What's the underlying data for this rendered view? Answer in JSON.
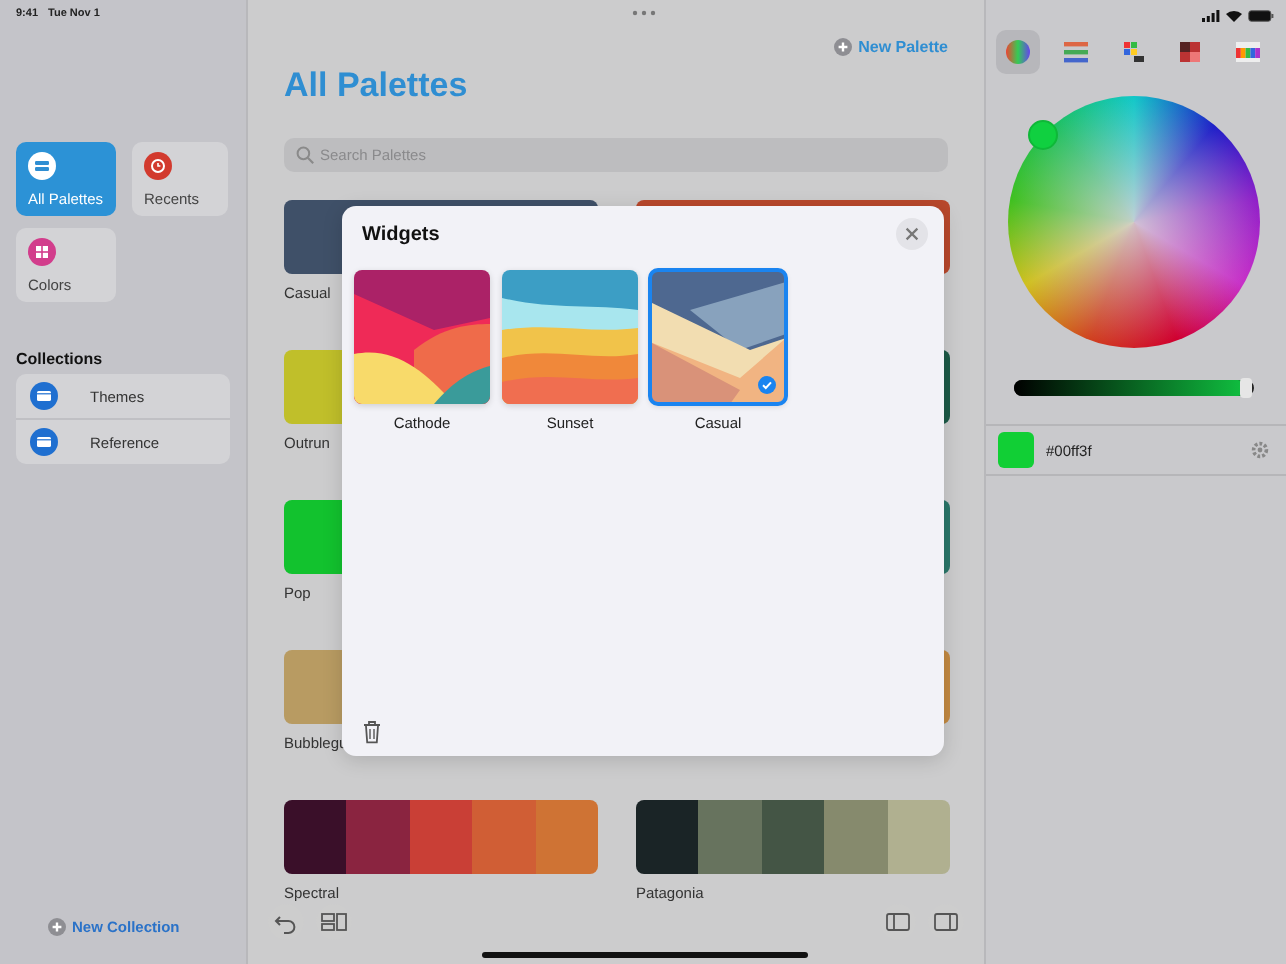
{
  "status_bar": {
    "time": "9:41",
    "date": "Tue Nov 1"
  },
  "sidebar": {
    "tiles": [
      {
        "label": "All Palettes",
        "selected": true,
        "color": "#ffffff"
      },
      {
        "label": "Recents",
        "selected": false,
        "color": "#d23a2e"
      },
      {
        "label": "Colors",
        "selected": false,
        "color": "#d23d8c"
      }
    ],
    "collections_title": "Collections",
    "collections": [
      {
        "label": "Themes"
      },
      {
        "label": "Reference"
      }
    ],
    "new_collection": "New Collection"
  },
  "main": {
    "new_palette": "New Palette",
    "title": "All Palettes",
    "search": {
      "placeholder": "Search Palettes"
    },
    "palettes": [
      {
        "name": "Casual",
        "swatches": [
          {
            "color": "#3f5068"
          }
        ]
      },
      {
        "swatches": [
          {
            "color": "#b9482c"
          }
        ]
      },
      {
        "name": "Outrun",
        "swatches": [
          {
            "color": "#c0bf2a"
          }
        ]
      },
      {
        "swatches": [
          {
            "color": "#1c5a47"
          }
        ]
      },
      {
        "name": "Pop",
        "swatches": [
          {
            "color": "#12c22e"
          }
        ]
      },
      {
        "swatches": [
          {
            "color": "#2a776a"
          }
        ]
      },
      {
        "name": "Bubblegu",
        "swatches": [
          {
            "color": "#b89b62"
          }
        ]
      },
      {
        "swatches": [
          {
            "color": "#c48a42"
          }
        ]
      },
      {
        "name": "Spectral",
        "swatches": [
          {
            "color": "#3a0f29"
          },
          {
            "color": "#8a2440"
          },
          {
            "color": "#c93f36"
          },
          {
            "color": "#d05e35"
          },
          {
            "color": "#cf7334"
          }
        ]
      },
      {
        "name": "Patagonia",
        "swatches": [
          {
            "color": "#1a2426"
          },
          {
            "color": "#67735e"
          },
          {
            "color": "#445545"
          },
          {
            "color": "#868a6d"
          },
          {
            "color": "#b0b090"
          }
        ]
      }
    ]
  },
  "widgets_sheet": {
    "title": "Widgets",
    "items": [
      {
        "label": "Cathode",
        "selected": false
      },
      {
        "label": "Sunset",
        "selected": false
      },
      {
        "label": "Casual",
        "selected": true
      }
    ]
  },
  "color_picker": {
    "modes": [
      {
        "selected": true
      },
      {
        "selected": false
      },
      {
        "selected": false
      },
      {
        "selected": false
      },
      {
        "selected": false
      }
    ],
    "brightness": {
      "level": 0.97
    },
    "hex": "#00ff3f"
  }
}
